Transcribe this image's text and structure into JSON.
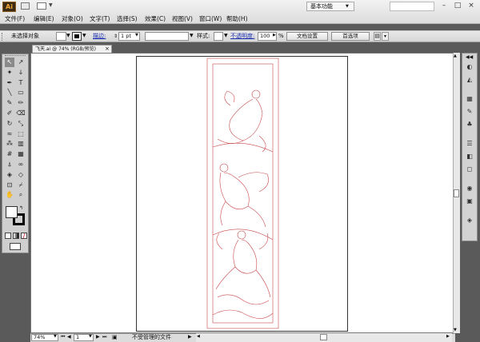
{
  "app": {
    "logo_text": "Ai",
    "workspace_label": "基本功能",
    "window_buttons": [
      "–",
      "□",
      "×"
    ]
  },
  "menu": [
    {
      "id": "file",
      "label": "文件(F)"
    },
    {
      "id": "edit",
      "label": "编辑(E)"
    },
    {
      "id": "object",
      "label": "对象(O)"
    },
    {
      "id": "text",
      "label": "文字(T)"
    },
    {
      "id": "select",
      "label": "选择(S)"
    },
    {
      "id": "effect",
      "label": "效果(C)"
    },
    {
      "id": "view",
      "label": "视图(V)"
    },
    {
      "id": "window",
      "label": "窗口(W)"
    },
    {
      "id": "help",
      "label": "帮助(H)"
    }
  ],
  "control_bar": {
    "selection_label": "未选择对象",
    "stroke_label": "描边:",
    "stroke_weight": "1 pt",
    "style_label": "样式:",
    "opacity_label": "不透明度:",
    "opacity_value": "100",
    "opacity_unit": "%",
    "doc_setup_label": "文档设置",
    "preferences_label": "首选项"
  },
  "document": {
    "tab_title": "飞天.ai @ 74% (RGB/预览)",
    "tab_close": "×"
  },
  "status_bar": {
    "zoom_value": "74%",
    "artboard_number": "1",
    "status_text": "不受管理的文件"
  },
  "toolbox": {
    "tools": [
      [
        "selection-tool",
        "↖"
      ],
      [
        "direct-selection-tool",
        "↗"
      ],
      [
        "magic-wand-tool",
        "✦"
      ],
      [
        "lasso-tool",
        "ↆ"
      ],
      [
        "pen-tool",
        "✒"
      ],
      [
        "type-tool",
        "T"
      ],
      [
        "line-tool",
        "╲"
      ],
      [
        "rectangle-tool",
        "▭"
      ],
      [
        "paintbrush-tool",
        "✎"
      ],
      [
        "pencil-tool",
        "✏"
      ],
      [
        "blob-brush-tool",
        "✐"
      ],
      [
        "eraser-tool",
        "⌫"
      ],
      [
        "rotate-tool",
        "↻"
      ],
      [
        "scale-tool",
        "⤡"
      ],
      [
        "warp-tool",
        "≈"
      ],
      [
        "free-transform-tool",
        "⬚"
      ],
      [
        "symbol-sprayer-tool",
        "⁂"
      ],
      [
        "column-graph-tool",
        "▥"
      ],
      [
        "mesh-tool",
        "#"
      ],
      [
        "gradient-tool",
        "▦"
      ],
      [
        "eyedropper-tool",
        "⍋"
      ],
      [
        "blend-tool",
        "∞"
      ],
      [
        "live-paint-tool",
        "◈"
      ],
      [
        "live-paint-select-tool",
        "◇"
      ],
      [
        "crop-tool",
        "⊡"
      ],
      [
        "slice-tool",
        "⌿"
      ],
      [
        "hand-tool",
        "✋"
      ],
      [
        "zoom-tool",
        "⌕"
      ]
    ]
  },
  "dock": {
    "icons": [
      "color-icon",
      "color-guide-icon",
      "swatches-icon",
      "brushes-icon",
      "symbols-icon",
      "stroke-icon",
      "gradient-icon",
      "transparency-icon",
      "appearance-icon",
      "graphic-styles-icon",
      "layers-icon"
    ],
    "glyphs": [
      "◐",
      "◭",
      "▦",
      "✎",
      "♣",
      "☰",
      "◧",
      "◻",
      "◉",
      "▣",
      "◈"
    ]
  },
  "colors": {
    "artwork_line": "#c9484b",
    "accent": "#f3a93a"
  }
}
